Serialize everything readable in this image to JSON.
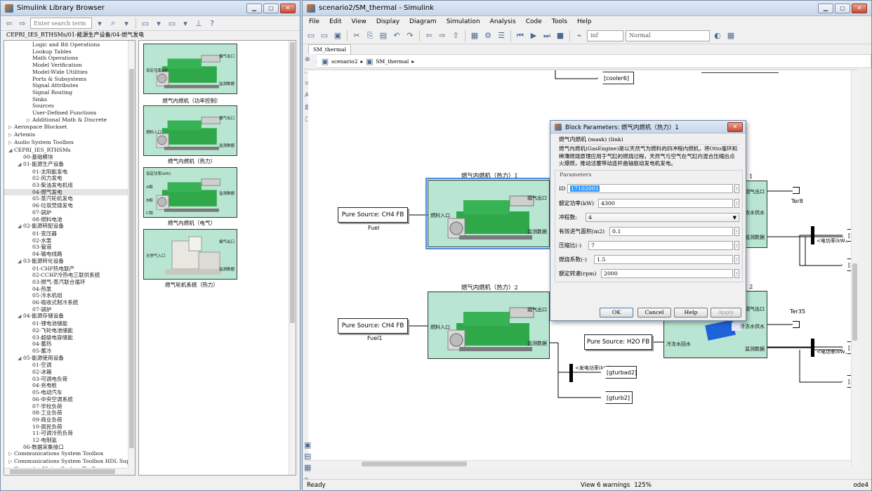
{
  "library_browser": {
    "title": "Simulink Library Browser",
    "search_placeholder": "Enter search term",
    "path": "CEPRI_IES_RTHSMs/01-能源生产设备/04-燃气发电",
    "tree": [
      {
        "label": "Logic and Bit Operations",
        "indent": 2,
        "arrow": ""
      },
      {
        "label": "Lookup Tables",
        "indent": 2,
        "arrow": ""
      },
      {
        "label": "Math Operations",
        "indent": 2,
        "arrow": ""
      },
      {
        "label": "Model Verification",
        "indent": 2,
        "arrow": ""
      },
      {
        "label": "Model-Wide Utilities",
        "indent": 2,
        "arrow": ""
      },
      {
        "label": "Ports & Subsystems",
        "indent": 2,
        "arrow": ""
      },
      {
        "label": "Signal Attributes",
        "indent": 2,
        "arrow": ""
      },
      {
        "label": "Signal Routing",
        "indent": 2,
        "arrow": ""
      },
      {
        "label": "Sinks",
        "indent": 2,
        "arrow": ""
      },
      {
        "label": "Sources",
        "indent": 2,
        "arrow": ""
      },
      {
        "label": "User-Defined Functions",
        "indent": 2,
        "arrow": ""
      },
      {
        "label": "Additional Math & Discrete",
        "indent": 2,
        "arrow": "▷"
      },
      {
        "label": "Aerospace Blockset",
        "indent": 0,
        "arrow": "▷"
      },
      {
        "label": "Artemis",
        "indent": 0,
        "arrow": "▷"
      },
      {
        "label": "Audio System Toolbox",
        "indent": 0,
        "arrow": "▷"
      },
      {
        "label": "CEPRI_IES_RTHSMs",
        "indent": 0,
        "arrow": "◢"
      },
      {
        "label": "00-基础模块",
        "indent": 1,
        "arrow": ""
      },
      {
        "label": "01-能源生产设备",
        "indent": 1,
        "arrow": "◢"
      },
      {
        "label": "01-太阳能发电",
        "indent": 2,
        "arrow": ""
      },
      {
        "label": "02-风力发电",
        "indent": 2,
        "arrow": ""
      },
      {
        "label": "03-柴油发电机组",
        "indent": 2,
        "arrow": ""
      },
      {
        "label": "04-燃气发电",
        "indent": 2,
        "arrow": "",
        "selected": true
      },
      {
        "label": "05-蒸汽轮机发电",
        "indent": 2,
        "arrow": ""
      },
      {
        "label": "06-垃圾焚烧发电",
        "indent": 2,
        "arrow": ""
      },
      {
        "label": "07-锅炉",
        "indent": 2,
        "arrow": ""
      },
      {
        "label": "08-燃料电池",
        "indent": 2,
        "arrow": ""
      },
      {
        "label": "02-能源转配设备",
        "indent": 1,
        "arrow": "◢"
      },
      {
        "label": "01-变压器",
        "indent": 2,
        "arrow": ""
      },
      {
        "label": "02-水泵",
        "indent": 2,
        "arrow": ""
      },
      {
        "label": "03-管道",
        "indent": 2,
        "arrow": ""
      },
      {
        "label": "04-输电线路",
        "indent": 2,
        "arrow": ""
      },
      {
        "label": "03-能源转化设备",
        "indent": 1,
        "arrow": "◢"
      },
      {
        "label": "01-CHP热电联产",
        "indent": 2,
        "arrow": ""
      },
      {
        "label": "02-CCHP冷热电三联供系统",
        "indent": 2,
        "arrow": ""
      },
      {
        "label": "03-燃气-蒸汽联合循环",
        "indent": 2,
        "arrow": ""
      },
      {
        "label": "04-热泵",
        "indent": 2,
        "arrow": ""
      },
      {
        "label": "05-冷水机组",
        "indent": 2,
        "arrow": ""
      },
      {
        "label": "06-吸收式制冷系统",
        "indent": 2,
        "arrow": ""
      },
      {
        "label": "07-锅炉",
        "indent": 2,
        "arrow": ""
      },
      {
        "label": "04-能源存储设备",
        "indent": 1,
        "arrow": "◢"
      },
      {
        "label": "01-锂电池储能",
        "indent": 2,
        "arrow": ""
      },
      {
        "label": "02-飞轮电池储能",
        "indent": 2,
        "arrow": ""
      },
      {
        "label": "03-超级电容储能",
        "indent": 2,
        "arrow": ""
      },
      {
        "label": "04-蓄热",
        "indent": 2,
        "arrow": ""
      },
      {
        "label": "05-蓄冷",
        "indent": 2,
        "arrow": ""
      },
      {
        "label": "05-能源使用设备",
        "indent": 1,
        "arrow": "◢"
      },
      {
        "label": "01-空调",
        "indent": 2,
        "arrow": ""
      },
      {
        "label": "02-冰箱",
        "indent": 2,
        "arrow": ""
      },
      {
        "label": "03-可调电负荷",
        "indent": 2,
        "arrow": ""
      },
      {
        "label": "04-充电桩",
        "indent": 2,
        "arrow": ""
      },
      {
        "label": "05-电动汽车",
        "indent": 2,
        "arrow": ""
      },
      {
        "label": "06-中央空调系统",
        "indent": 2,
        "arrow": ""
      },
      {
        "label": "07-学校负荷",
        "indent": 2,
        "arrow": ""
      },
      {
        "label": "08-工业负荷",
        "indent": 2,
        "arrow": ""
      },
      {
        "label": "09-商业负荷",
        "indent": 2,
        "arrow": ""
      },
      {
        "label": "10-居民负荷",
        "indent": 2,
        "arrow": ""
      },
      {
        "label": "11-可调冷热负荷",
        "indent": 2,
        "arrow": ""
      },
      {
        "label": "12-电制氢",
        "indent": 2,
        "arrow": ""
      },
      {
        "label": "06-数据采集接口",
        "indent": 1,
        "arrow": ""
      },
      {
        "label": "Communications System Toolbox",
        "indent": 0,
        "arrow": "▷"
      },
      {
        "label": "Communications System Toolbox HDL Support",
        "indent": 0,
        "arrow": "▷"
      },
      {
        "label": "Computer Vision System Toolbox",
        "indent": 0,
        "arrow": "▷"
      },
      {
        "label": "Control System Toolbox",
        "indent": 0,
        "arrow": "▷"
      }
    ],
    "blocks": [
      {
        "name": "燃气内燃机（功率控制）",
        "in": [
          "设定功率kW"
        ],
        "out": [
          "烟气出口",
          "监测数据"
        ]
      },
      {
        "name": "燃气内燃机（热力）",
        "in": [
          "燃料入口"
        ],
        "out": [
          "烟气出口",
          "监测数据"
        ]
      },
      {
        "name": "燃气内燃机（电气）",
        "in": [
          "设定功率(kW)",
          "A相",
          "B相",
          "C相"
        ],
        "out": [
          "监测数据"
        ]
      },
      {
        "name": "燃气轮机系统（热力）",
        "in": [
          "天然气入口"
        ],
        "out": [
          "烟气出口",
          "监测数据"
        ]
      }
    ]
  },
  "simulink": {
    "title": "scenario2/SM_thermal - Simulink",
    "menu": [
      "File",
      "Edit",
      "View",
      "Display",
      "Diagram",
      "Simulation",
      "Analysis",
      "Code",
      "Tools",
      "Help"
    ],
    "stop_time": "inf",
    "sim_mode": "Normal",
    "tab": "SM_thermal",
    "breadcrumb": [
      "scenario2",
      "SM_thermal"
    ],
    "status_left": "Ready",
    "status_center": "View 6 warnings",
    "zoom": "125%",
    "solver": "ode4",
    "diagram": {
      "block1_title": "燃气内燃机（热力）1",
      "block2_title": "燃气内燃机（热力）2",
      "block3_title": "1",
      "block4_title": "2",
      "port_fuel_in": "燃料入口",
      "port_exhaust_out": "烟气出口",
      "port_monitor": "监测数据",
      "port_coolwater_in": "冷冻水回水",
      "port_coolwater_out": "冷冻水供水",
      "src1": "Pure Source: CH4   FB",
      "src2": "Pure Source: CH4   FB",
      "src3": "Pure Source: H2O FB",
      "src1_label": "Fuel",
      "src2_label": "Fuel1",
      "goto_cooler": "[cooler6]",
      "goto_gturbad2": "[gturbad2]",
      "goto_gturb2": "[gturb2]",
      "goto_hc1": "[HC_",
      "goto_abs1": "[absor",
      "goto_hc2": "[HC_",
      "goto_abs2": "[absor",
      "sig_power": "<发电功率(kW)>",
      "sig_power2": "<电功率(kW)>",
      "sig_power3": "<电功率(kW)>",
      "term1": "Ter8",
      "term2": "Ter35"
    }
  },
  "dialog": {
    "title": "Block Parameters: 燃气内燃机（热力）1",
    "mask_title": "燃气内燃机 (mask) (link)",
    "description": "燃气内燃机(GasEngine)是以天然气为燃料的四冲程内燃机，将Otto循环和稀薄燃烧原理应用于气缸的燃烧过程，天然气与空气在气缸内混合压缩后点火爆燃，推动活塞带动连杆曲轴驱动发电机发电。",
    "section": "Parameters",
    "fields": [
      {
        "label": "ID",
        "value": "17102001"
      },
      {
        "label": "额定功率(kW)",
        "value": "4300"
      },
      {
        "label": "冲程数:",
        "value": "4"
      },
      {
        "label": "有效进气面积(m2)",
        "value": "0.1"
      },
      {
        "label": "压缩比(-)",
        "value": "7"
      },
      {
        "label": "燃烧系数(-)",
        "value": "1.5"
      },
      {
        "label": "额定转速(rpm)",
        "value": "2000"
      }
    ],
    "buttons": {
      "ok": "OK",
      "cancel": "Cancel",
      "help": "Help",
      "apply": "Apply"
    }
  },
  "colors": {
    "block_fill": "#b9e6d2",
    "engine_green": "#2fa84a",
    "title_bar": "#c7d6ea",
    "selection": "#3399ff"
  }
}
